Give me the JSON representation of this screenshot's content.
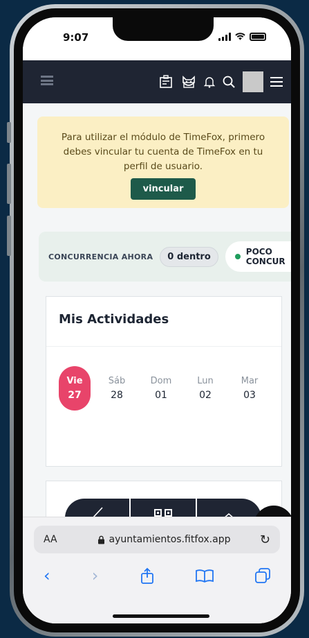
{
  "statusbar": {
    "time": "9:07"
  },
  "alert": {
    "message": "Para utilizar el módulo de TimeFox, primero debes vincular tu cuenta de TimeFox en tu perfil de usuario.",
    "button_label": "vincular"
  },
  "concurrency": {
    "label": "CONCURRENCIA AHORA",
    "count": "0 dentro",
    "status_line1": "POCO",
    "status_line2": "CONCUR",
    "status_color": "#1f9d5d"
  },
  "activities": {
    "title": "Mis Actividades",
    "days": [
      {
        "name": "Vie",
        "num": "27",
        "active": true
      },
      {
        "name": "Sáb",
        "num": "28",
        "active": false
      },
      {
        "name": "Dom",
        "num": "01",
        "active": false
      },
      {
        "name": "Lun",
        "num": "02",
        "active": false
      },
      {
        "name": "Mar",
        "num": "03",
        "active": false
      }
    ]
  },
  "browser": {
    "aa_label": "AA",
    "url": "ayuntamientos.fitfox.app",
    "reload": "↻"
  },
  "colors": {
    "nav": "#1f2533",
    "accent": "#e8446a",
    "alert_bg": "#fbefc4",
    "button": "#1e5a4a"
  }
}
